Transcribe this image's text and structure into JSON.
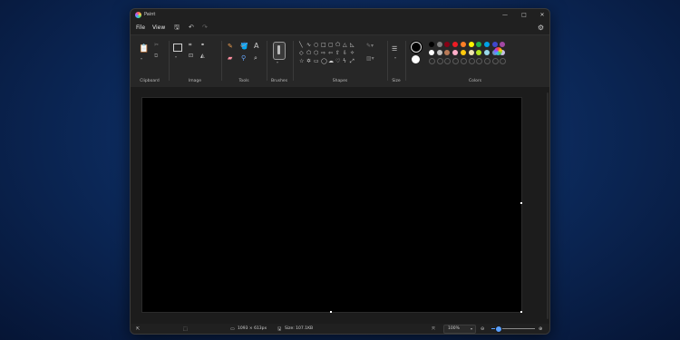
{
  "window": {
    "title": "Paint"
  },
  "window_controls": {
    "minimize": "—",
    "maximize": "□",
    "close": "✕"
  },
  "menu": {
    "file": "File",
    "view": "View"
  },
  "ribbon": {
    "groups": {
      "clipboard": "Clipboard",
      "image": "Image",
      "tools": "Tools",
      "brushes": "Brushes",
      "shapes": "Shapes",
      "size": "Size",
      "colors": "Colors"
    },
    "tools_text_icon": "A"
  },
  "palette": {
    "row1": [
      "#000000",
      "#7f7f7f",
      "#880015",
      "#ed1c24",
      "#ff7f27",
      "#fff200",
      "#22b14c",
      "#00a2e8",
      "#3f48cc",
      "#a349a4"
    ],
    "row2": [
      "#ffffff",
      "#c3c3c3",
      "#b97a57",
      "#ffaec9",
      "#ffc90e",
      "#efe4b0",
      "#b5e61d",
      "#99d9ea",
      "#7092be",
      "#c8bfe7"
    ],
    "primary": "#000000",
    "secondary": "#ffffff"
  },
  "status": {
    "dimensions": "1093 × 613px",
    "size": "Size: 107.1KB",
    "zoom": "100%"
  }
}
